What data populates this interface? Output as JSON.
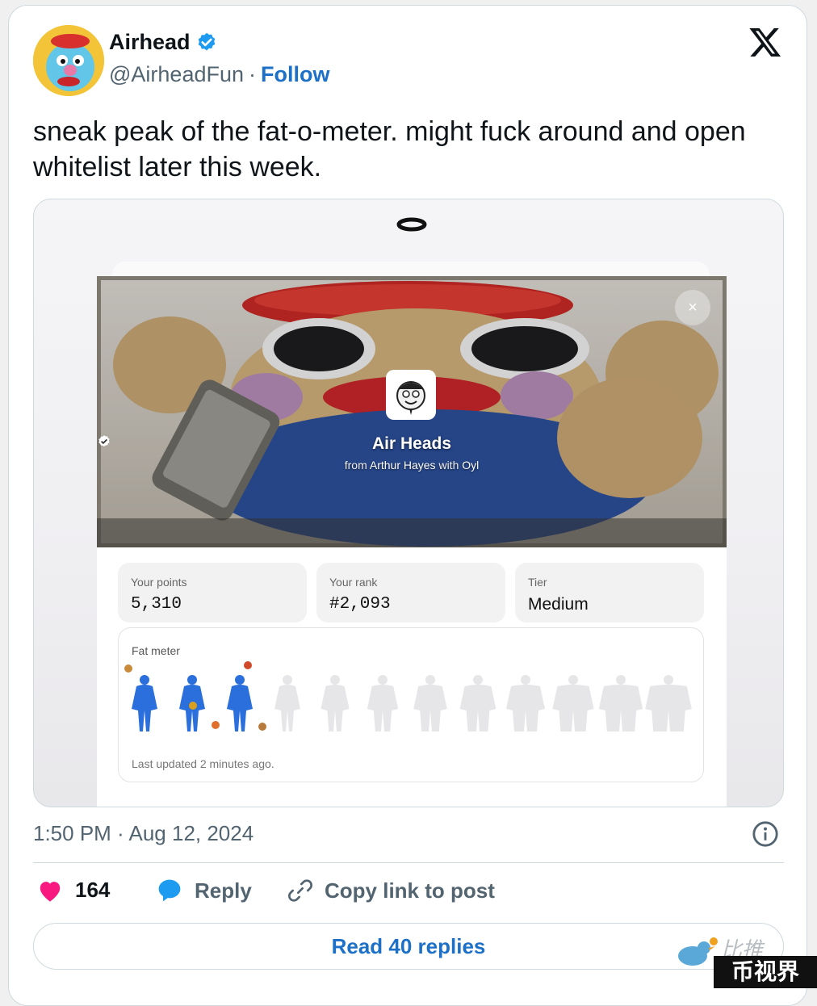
{
  "author": {
    "display_name": "Airhead",
    "handle": "@AirheadFun",
    "separator": "·",
    "follow_label": "Follow"
  },
  "tweet": {
    "text": "sneak peak of the fat-o-meter. might fuck around and open whitelist later this week."
  },
  "embed": {
    "close_glyph": "×",
    "collection_name": "Air Heads",
    "from_prefix": "from",
    "from_name": "Arthur Hayes",
    "with_prefix": "with",
    "with_name": "Oyl",
    "stats": [
      {
        "label": "Your points",
        "value": "5,310"
      },
      {
        "label": "Your rank",
        "value": "#2,093"
      },
      {
        "label": "Tier",
        "value": "Medium"
      }
    ],
    "fat_meter": {
      "title": "Fat meter",
      "filled": 3,
      "total": 12,
      "active_color": "#2a6fdb",
      "inactive_color": "#e6e6e8",
      "footer": "Last updated 2 minutes ago."
    }
  },
  "meta": {
    "timestamp": "1:50 PM · Aug 12, 2024"
  },
  "actions": {
    "likes": "164",
    "reply_label": "Reply",
    "copy_label": "Copy link to post",
    "read_replies_label": "Read 40 replies"
  },
  "watermark": {
    "text1": "比推",
    "text2": "币视界"
  },
  "colors": {
    "like": "#f91880",
    "reply": "#1d9bf0",
    "link": "#1d70c8",
    "verified": "#1d9bf0"
  }
}
